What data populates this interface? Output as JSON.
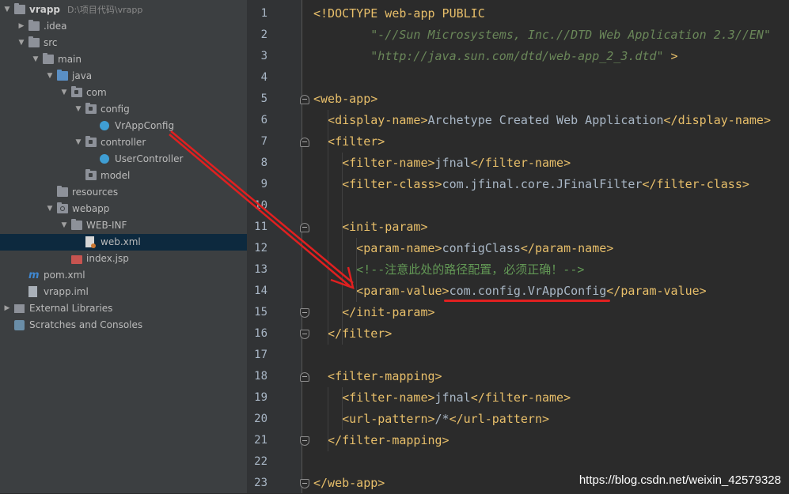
{
  "project_tree": {
    "items": [
      {
        "label": "vrapp",
        "path": "D:\\项目代码\\vrapp",
        "depth": 0,
        "arrow": "▼",
        "icon": "module-folder-icon",
        "bold": true
      },
      {
        "label": ".idea",
        "depth": 1,
        "arrow": "▶",
        "icon": "folder-icon"
      },
      {
        "label": "src",
        "depth": 1,
        "arrow": "▼",
        "icon": "folder-icon"
      },
      {
        "label": "main",
        "depth": 2,
        "arrow": "▼",
        "icon": "folder-icon"
      },
      {
        "label": "java",
        "depth": 3,
        "arrow": "▼",
        "icon": "source-folder-icon"
      },
      {
        "label": "com",
        "depth": 4,
        "arrow": "▼",
        "icon": "package-icon"
      },
      {
        "label": "config",
        "depth": 5,
        "arrow": "▼",
        "icon": "package-icon"
      },
      {
        "label": "VrAppConfig",
        "depth": 6,
        "arrow": "",
        "icon": "java-class-icon"
      },
      {
        "label": "controller",
        "depth": 5,
        "arrow": "▼",
        "icon": "package-icon"
      },
      {
        "label": "UserController",
        "depth": 6,
        "arrow": "",
        "icon": "java-class-icon"
      },
      {
        "label": "model",
        "depth": 5,
        "arrow": "",
        "icon": "package-icon"
      },
      {
        "label": "resources",
        "depth": 3,
        "arrow": "",
        "icon": "folder-icon"
      },
      {
        "label": "webapp",
        "depth": 3,
        "arrow": "▼",
        "icon": "web-folder-icon"
      },
      {
        "label": "WEB-INF",
        "depth": 4,
        "arrow": "▼",
        "icon": "folder-icon"
      },
      {
        "label": "web.xml",
        "depth": 5,
        "arrow": "",
        "icon": "xml-file-icon",
        "selected": true
      },
      {
        "label": "index.jsp",
        "depth": 4,
        "arrow": "",
        "icon": "jsp-file-icon"
      },
      {
        "label": "pom.xml",
        "depth": 1,
        "arrow": "",
        "icon": "maven-pom-icon"
      },
      {
        "label": "vrapp.iml",
        "depth": 1,
        "arrow": "",
        "icon": "iml-file-icon"
      },
      {
        "label": "External Libraries",
        "depth": 0,
        "arrow": "▶",
        "icon": "libraries-icon"
      },
      {
        "label": "Scratches and Consoles",
        "depth": 0,
        "arrow": "",
        "icon": "scratches-icon"
      }
    ]
  },
  "editor": {
    "lines": [
      {
        "n": "1",
        "tokens": [
          {
            "t": "<!DOCTYPE web-app PUBLIC",
            "c": "tag"
          }
        ]
      },
      {
        "n": "2",
        "tokens": [
          {
            "t": "        \"-//Sun Microsystems, Inc.//DTD Web Application 2.3//EN\"",
            "c": "str"
          }
        ]
      },
      {
        "n": "3",
        "tokens": [
          {
            "t": "        \"http://java.sun.com/dtd/web-app_2_3.dtd\"",
            "c": "str"
          },
          {
            "t": " >",
            "c": "tag"
          }
        ]
      },
      {
        "n": "4",
        "tokens": []
      },
      {
        "n": "5",
        "tokens": [
          {
            "t": "<web-app>",
            "c": "tag"
          }
        ]
      },
      {
        "n": "6",
        "tokens": [
          {
            "t": "  <display-name>",
            "c": "tag"
          },
          {
            "t": "Archetype Created Web Application",
            "c": "txt"
          },
          {
            "t": "</display-name>",
            "c": "tag"
          }
        ]
      },
      {
        "n": "7",
        "tokens": [
          {
            "t": "  <filter>",
            "c": "tag"
          }
        ]
      },
      {
        "n": "8",
        "tokens": [
          {
            "t": "    <filter-name>",
            "c": "tag"
          },
          {
            "t": "jfnal",
            "c": "txt"
          },
          {
            "t": "</filter-name>",
            "c": "tag"
          }
        ]
      },
      {
        "n": "9",
        "tokens": [
          {
            "t": "    <filter-class>",
            "c": "tag"
          },
          {
            "t": "com.jfinal.core.JFinalFilter",
            "c": "txt"
          },
          {
            "t": "</filter-class>",
            "c": "tag"
          }
        ]
      },
      {
        "n": "10",
        "tokens": []
      },
      {
        "n": "11",
        "tokens": [
          {
            "t": "    <init-param>",
            "c": "tag"
          }
        ]
      },
      {
        "n": "12",
        "tokens": [
          {
            "t": "      <param-name>",
            "c": "tag"
          },
          {
            "t": "configClass",
            "c": "txt"
          },
          {
            "t": "</param-name>",
            "c": "tag"
          }
        ]
      },
      {
        "n": "13",
        "tokens": [
          {
            "t": "      <!--注意此处的路径配置，必须正确！-->",
            "c": "cmt"
          }
        ]
      },
      {
        "n": "14",
        "tokens": [
          {
            "t": "      <param-value>",
            "c": "tag"
          },
          {
            "t": "com.config.VrAppConfig",
            "c": "txt"
          },
          {
            "t": "</param-value>",
            "c": "tag"
          }
        ]
      },
      {
        "n": "15",
        "tokens": [
          {
            "t": "    </init-param>",
            "c": "tag"
          }
        ]
      },
      {
        "n": "16",
        "tokens": [
          {
            "t": "  </filter>",
            "c": "tag"
          }
        ]
      },
      {
        "n": "17",
        "tokens": []
      },
      {
        "n": "18",
        "tokens": [
          {
            "t": "  <filter-mapping>",
            "c": "tag"
          }
        ]
      },
      {
        "n": "19",
        "tokens": [
          {
            "t": "    <filter-name>",
            "c": "tag"
          },
          {
            "t": "jfnal",
            "c": "txt"
          },
          {
            "t": "</filter-name>",
            "c": "tag"
          }
        ]
      },
      {
        "n": "20",
        "tokens": [
          {
            "t": "    <url-pattern>",
            "c": "tag"
          },
          {
            "t": "/*",
            "c": "txt"
          },
          {
            "t": "</url-pattern>",
            "c": "tag"
          }
        ]
      },
      {
        "n": "21",
        "tokens": [
          {
            "t": "  </filter-mapping>",
            "c": "tag"
          }
        ]
      },
      {
        "n": "22",
        "tokens": []
      },
      {
        "n": "23",
        "tokens": [
          {
            "t": "</web-app>",
            "c": "tag"
          }
        ]
      }
    ]
  },
  "watermark": "https://blog.csdn.net/weixin_42579328",
  "colors": {
    "annotation_red": "#e02020",
    "tag": "#e8bf6a",
    "string": "#6a8759",
    "comment": "#629755"
  }
}
